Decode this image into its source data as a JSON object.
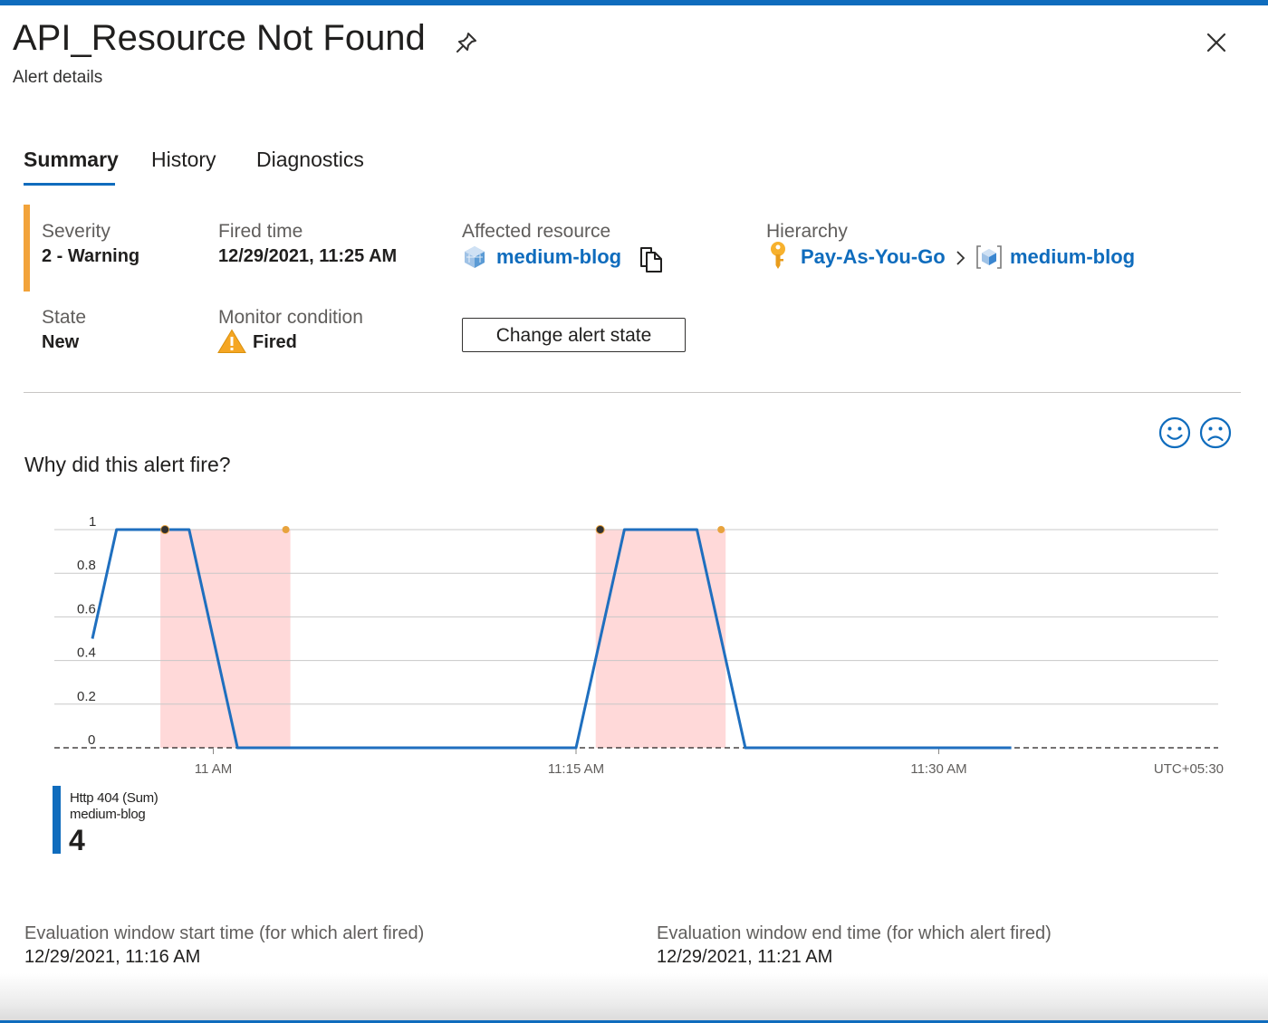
{
  "header": {
    "title": "API_Resource Not Found",
    "subtitle": "Alert details"
  },
  "tabs": [
    {
      "label": "Summary",
      "active": true
    },
    {
      "label": "History",
      "active": false
    },
    {
      "label": "Diagnostics",
      "active": false
    }
  ],
  "summary": {
    "severity": {
      "label": "Severity",
      "value": "2 - Warning"
    },
    "fired_time": {
      "label": "Fired time",
      "value": "12/29/2021, 11:25 AM"
    },
    "affected_resource": {
      "label": "Affected resource",
      "value": "medium-blog"
    },
    "hierarchy": {
      "label": "Hierarchy",
      "subscription": "Pay-As-You-Go",
      "resource": "medium-blog"
    },
    "state": {
      "label": "State",
      "value": "New"
    },
    "monitor_condition": {
      "label": "Monitor condition",
      "value": "Fired"
    },
    "change_state_button": "Change alert state"
  },
  "why": {
    "title": "Why did this alert fire?"
  },
  "chart_data": {
    "type": "line",
    "x": [
      "10:55 AM",
      "10:56 AM",
      "10:57 AM",
      "10:58 AM",
      "10:59 AM",
      "11:00 AM",
      "11:01 AM",
      "11:02 AM",
      "11:03 AM",
      "11:04 AM",
      "11:05 AM",
      "11:06 AM",
      "11:07 AM",
      "11:08 AM",
      "11:09 AM",
      "11:10 AM",
      "11:11 AM",
      "11:12 AM",
      "11:13 AM",
      "11:14 AM",
      "11:15 AM",
      "11:16 AM",
      "11:17 AM",
      "11:18 AM",
      "11:19 AM",
      "11:20 AM",
      "11:21 AM",
      "11:22 AM",
      "11:23 AM",
      "11:24 AM",
      "11:25 AM",
      "11:26 AM",
      "11:27 AM",
      "11:28 AM",
      "11:29 AM",
      "11:30 AM",
      "11:31 AM",
      "11:32 AM",
      "11:33 AM"
    ],
    "series": [
      {
        "name": "Http 404 (Sum)",
        "values": [
          0.5,
          1,
          1,
          1,
          1,
          0.5,
          0,
          0,
          0,
          0,
          0,
          0,
          0,
          0,
          0,
          0,
          0,
          0,
          0,
          0,
          0,
          0.5,
          1,
          1,
          1,
          1,
          0.5,
          0,
          0,
          0,
          0,
          0,
          0,
          0,
          0,
          0,
          0,
          0,
          0
        ]
      }
    ],
    "y_ticks": [
      "0",
      "0.2",
      "0.4",
      "0.6",
      "0.8",
      "1"
    ],
    "ylim": [
      0,
      1
    ],
    "x_tick_labels": [
      "11 AM",
      "11:15 AM",
      "11:30 AM"
    ],
    "timezone": "UTC+05:30",
    "threshold": 0,
    "fired_windows": [
      {
        "start": "10:58 AM",
        "end": "11:03 AM"
      },
      {
        "start": "11:16 AM",
        "end": "11:21 AM"
      }
    ],
    "grid": true,
    "colors": {
      "line": "#1f6fbf",
      "fired_window": "#ffd9d9",
      "marker_start": "#323130",
      "marker_end": "#e8a33d"
    }
  },
  "legend": {
    "metric": "Http 404 (Sum)",
    "resource": "medium-blog",
    "value": "4"
  },
  "evaluation": {
    "start": {
      "label": "Evaluation window start time (for which alert fired)",
      "value": "12/29/2021, 11:16 AM"
    },
    "end": {
      "label": "Evaluation window end time (for which alert fired)",
      "value": "12/29/2021, 11:21 AM"
    }
  },
  "icons": {
    "pin": "pin-icon",
    "close": "close-icon",
    "copy": "copy-icon",
    "resource": "app-service-icon",
    "subscription": "key-icon",
    "hierarchy_separator": "chevron-right-icon",
    "warning": "warning-icon",
    "smile": "smile-feedback-icon",
    "frown": "frown-feedback-icon"
  },
  "colors": {
    "accent": "#0f6cbd",
    "severity_bar": "#f2a33a",
    "link": "#0f6cbd"
  }
}
